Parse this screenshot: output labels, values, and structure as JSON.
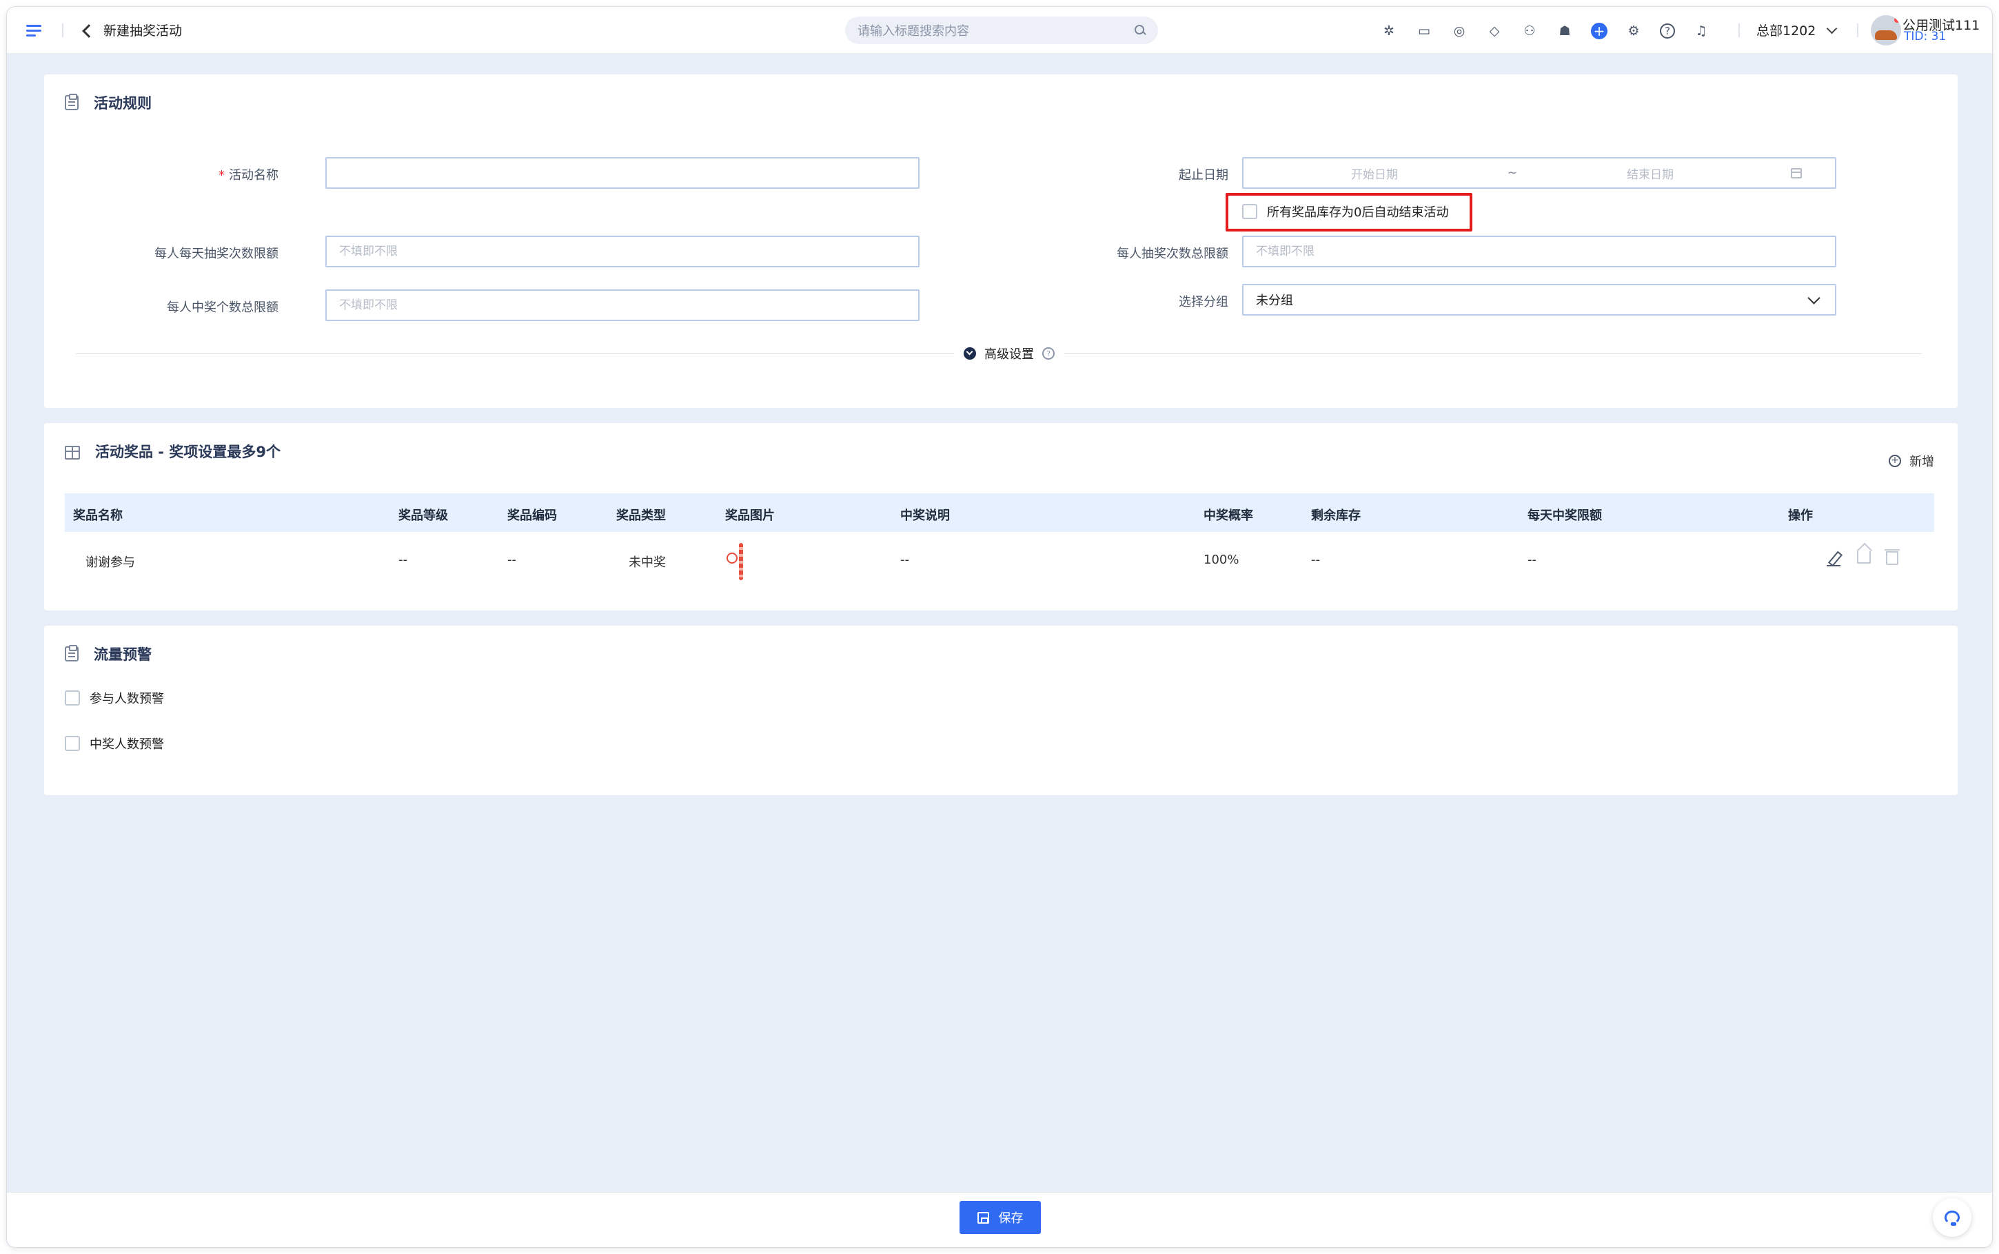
{
  "header": {
    "back_title": "新建抽奖活动",
    "search_placeholder": "请输入标题搜索内容",
    "icons": [
      "sparkle-icon",
      "message-icon",
      "compass-icon",
      "tag-icon",
      "users-icon",
      "hat-icon",
      "plus-circle-icon",
      "gear-icon",
      "help-icon",
      "bell-icon"
    ],
    "plus_glyph": "+",
    "help_glyph": "?",
    "org": "总部1202",
    "user_name": "公用测试111",
    "user_tid": "TID: 31"
  },
  "rules": {
    "title": "活动规则",
    "required_mark": "*",
    "name_label": "活动名称",
    "name_value": "",
    "date_label": "起止日期",
    "date_start_placeholder": "开始日期",
    "date_separator": "~",
    "date_end_placeholder": "结束日期",
    "auto_end_label": "所有奖品库存为0后自动结束活动",
    "daily_limit_label": "每人每天抽奖次数限额",
    "daily_limit_placeholder": "不填即不限",
    "total_draw_label": "每人抽奖次数总限额",
    "total_draw_placeholder": "不填即不限",
    "win_limit_label": "每人中奖个数总限额",
    "win_limit_placeholder": "不填即不限",
    "group_label": "选择分组",
    "group_value": "未分组",
    "advanced_label": "高级设置",
    "advanced_help_glyph": "?"
  },
  "prizes": {
    "title": "活动奖品 - 奖项设置最多9个",
    "add_glyph": "+",
    "add_label": "新增",
    "columns": [
      "奖品名称",
      "奖品等级",
      "奖品编码",
      "奖品类型",
      "奖品图片",
      "中奖说明",
      "中奖概率",
      "剩余库存",
      "每天中奖限额",
      "操作"
    ],
    "rows": [
      {
        "name": "谢谢参与",
        "level": "--",
        "code": "--",
        "type": "未中奖",
        "desc": "--",
        "probability": "100%",
        "stock": "--",
        "daily_limit": "--"
      }
    ]
  },
  "traffic": {
    "title": "流量预警",
    "participants_label": "参与人数预警",
    "winners_label": "中奖人数预警"
  },
  "footer": {
    "save_label": "保存"
  },
  "colors": {
    "primary": "#2f6bf2",
    "highlight": "#e41c1c",
    "table_header_bg": "#e7f0ff",
    "page_bg": "#e8eef8"
  }
}
